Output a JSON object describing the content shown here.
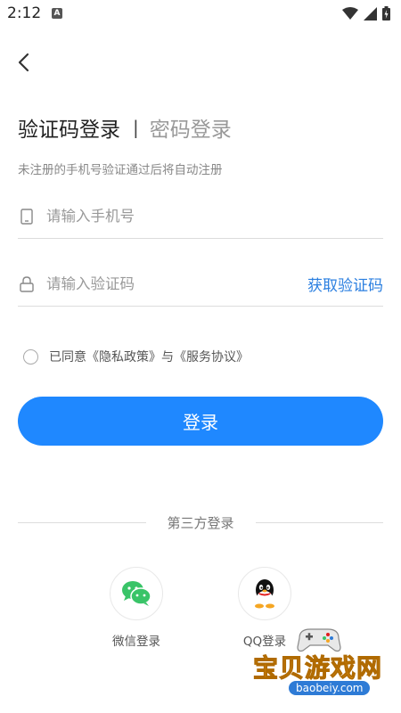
{
  "status_bar": {
    "time": "2:12",
    "badge": "A"
  },
  "tabs": {
    "active": "验证码登录",
    "separator": "|",
    "inactive": "密码登录"
  },
  "subtitle": "未注册的手机号验证通过后将自动注册",
  "phone_field": {
    "placeholder": "请输入手机号",
    "icon": "phone-icon"
  },
  "code_field": {
    "placeholder": "请输入验证码",
    "icon": "lock-icon",
    "get_code": "获取验证码"
  },
  "agreement": {
    "prefix": "已同意",
    "privacy": "《隐私政策》",
    "conjunction": "与",
    "service": "《服务协议》"
  },
  "login_button": "登录",
  "third_party": {
    "title": "第三方登录",
    "wechat": {
      "label": "微信登录",
      "icon": "wechat-icon"
    },
    "qq": {
      "label": "QQ登录",
      "icon": "qq-icon"
    }
  },
  "watermark": {
    "title": "宝贝游戏网",
    "url": "baobeiy.com"
  },
  "colors": {
    "primary": "#1f88ff",
    "link": "#2b7fe0",
    "wechat": "#39c468"
  }
}
